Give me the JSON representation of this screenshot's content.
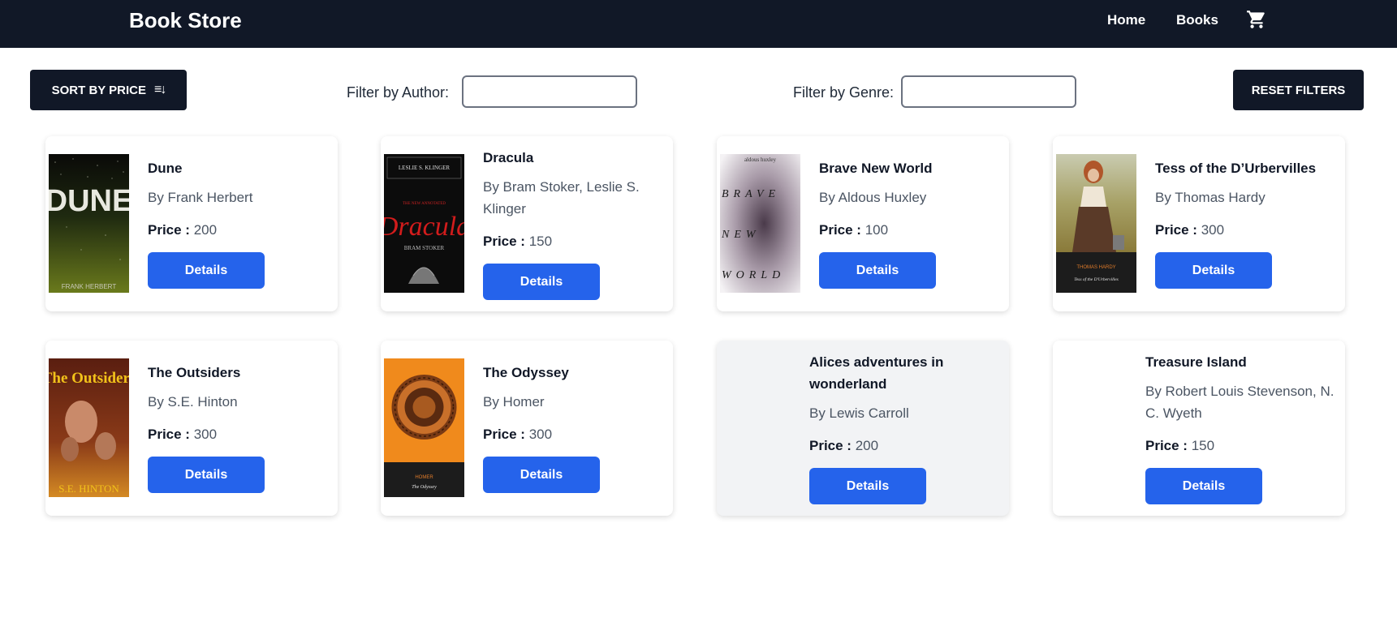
{
  "header": {
    "brand": "Book Store",
    "nav": {
      "home": "Home",
      "books": "Books"
    },
    "cart_icon": "shopping-cart-icon"
  },
  "toolbar": {
    "sort_label": "SORT BY PRICE",
    "sort_glyph": "≡↓",
    "filter_author_label": "Filter by Author:",
    "filter_author_value": "",
    "filter_genre_label": "Filter by Genre:",
    "filter_genre_value": "",
    "reset_label": "RESET FILTERS"
  },
  "price_label": "Price :",
  "books": [
    {
      "title": "Dune",
      "author": "By Frank Herbert",
      "price": "200",
      "details": "Details"
    },
    {
      "title": "Dracula",
      "author": "By Bram Stoker, Leslie S. Klinger",
      "price": "150",
      "details": "Details"
    },
    {
      "title": "Brave New World",
      "author": "By Aldous Huxley",
      "price": "100",
      "details": "Details"
    },
    {
      "title": "Tess of the D’Urbervilles",
      "author": "By Thomas Hardy",
      "price": "300",
      "details": "Details"
    },
    {
      "title": "The Outsiders",
      "author": "By S.E. Hinton",
      "price": "300",
      "details": "Details"
    },
    {
      "title": "The Odyssey",
      "author": "By Homer",
      "price": "300",
      "details": "Details"
    },
    {
      "title": "Alices adventures in wonderland",
      "author": "By Lewis Carroll",
      "price": "200",
      "details": "Details"
    },
    {
      "title": "Treasure Island",
      "author": "By Robert Louis Stevenson, N. C. Wyeth",
      "price": "150",
      "details": "Details"
    }
  ],
  "cover_art": {
    "dune": {
      "word": "DUNE",
      "footer": "FRANK HERBERT"
    },
    "dracula": {
      "top": "LESLIE S. KLINGER",
      "sub": "THE NEW ANNOTATED",
      "word": "Dracula",
      "author": "BRAM STOKER"
    },
    "brave": {
      "top": "aldous huxley",
      "l1": "BRAVE",
      "l2": "NEW",
      "l3": "WORLD"
    },
    "tess": {
      "author": "THOMAS HARDY",
      "title": "Tess of the D'Urbervilles"
    },
    "outsiders": {
      "word": "The Outsiders",
      "author": "S.E. HINTON"
    },
    "odyssey": {
      "author": "HOMER",
      "title": "The Odyssey"
    }
  },
  "colors": {
    "navbar": "#111827",
    "primary": "#2563eb",
    "card_highlight": "#f2f3f5"
  }
}
